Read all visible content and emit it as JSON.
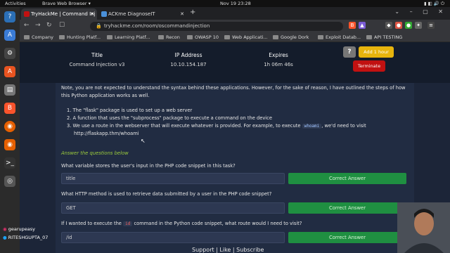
{
  "system": {
    "activities": "Activities",
    "app_name": "Brave Web Browser ▾",
    "clock": "Nov 19  23:28"
  },
  "browser": {
    "tabs": [
      {
        "title": "TryHackMe | Command Inj",
        "active": true
      },
      {
        "title": "ACKme DiagnoseIT",
        "active": false
      }
    ],
    "url": "tryhackme.com/room/oscommandinjection",
    "bookmarks": [
      "Company",
      "Hunting Platf...",
      "Learning Platf...",
      "Recon",
      "OWASP 10",
      "Web Applicati...",
      "Google Dork",
      "Exploit Datab...",
      "API TESTING"
    ]
  },
  "machine": {
    "title_label": "Title",
    "title_value": "Command Injection v3",
    "ip_label": "IP Address",
    "ip_value": "10.10.154.187",
    "expires_label": "Expires",
    "expires_value": "1h 06m 46s",
    "help_label": "?",
    "add_hour_label": "Add 1 hour",
    "terminate_label": "Terminate"
  },
  "content": {
    "intro": "Note, you are not expected to understand the syntax behind these applications. However, for the sake of reason, I have outlined the steps of how this Python application works as well.",
    "step1": "1. The \"flask\" package is used to set up a web server",
    "step2": "2. A function that uses the \"subprocess\" package to execute a command on the device",
    "step3_pre": "3. We use a route in the webserver that will execute whatever is provided. For example, to execute",
    "step3_code": "whoami",
    "step3_post": ", we'd need to visit",
    "step3_url": "http://flaskapp.thm/whoami",
    "answer_heading": "Answer the questions below"
  },
  "questions": [
    {
      "text": "What variable stores the user's input in the PHP code snippet in this task?",
      "answer": "title",
      "button": "Correct Answer"
    },
    {
      "text": "What HTTP method is used to retrieve data submitted by a user in the PHP code snippet?",
      "answer": "GET",
      "button": "Correct Answer"
    },
    {
      "text_pre": "If I wanted to execute the",
      "code": "id",
      "text_post": "command in the Python code snippet, what route would I need to visit?",
      "answer": "/id",
      "button": "Correct Answer"
    }
  ],
  "footer": {
    "support": "Support",
    "sep": " | ",
    "like": "Like",
    "subscribe": "Subscribe"
  },
  "social": {
    "handle1": "gearupeasy",
    "handle2": "RITESHGUPTA_07"
  },
  "colors": {
    "page_bg": "#1c2538",
    "card_bg": "#212c42",
    "correct_green": "#1f8f41",
    "answer_heading": "#9ccc3c",
    "add_hour": "#e7b40d",
    "terminate": "#c11111"
  }
}
